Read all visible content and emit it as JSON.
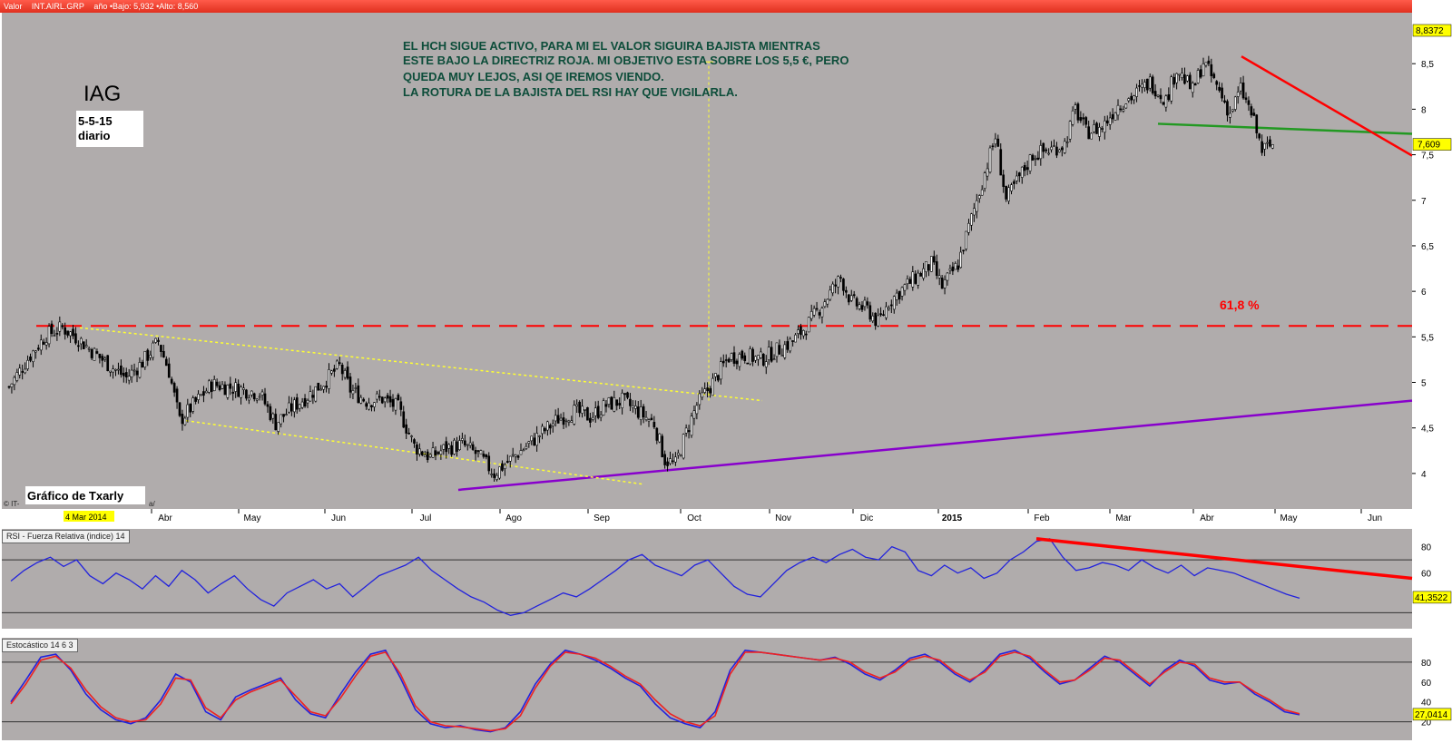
{
  "main_header": {
    "valor_label": "Valor",
    "symbol": "INT.AIRL.GRP",
    "range_text": "año •Bajo: 5,932 •Alto: 8,560"
  },
  "annotations": {
    "ticker": "IAG",
    "date_line1": "5-5-15",
    "date_line2": "diario",
    "comment_lines": [
      "EL  HCH  SIGUE  ACTIVO, PARA  MI EL VALOR SIGUIRA BAJISTA MIENTRAS",
      "ESTE BAJO LA  DIRECTRIZ ROJA. MI OBJETIVO ESTA  SOBRE LOS  5,5 €, PERO",
      "QUEDA MUY LEJOS, ASI QE IREMOS VIENDO.",
      "LA  ROTURA  DE LA BAJISTA DEL RSI HAY QUE VIGILARLA."
    ],
    "fib_label": "61,8 %",
    "credit": "Gráfico de Txarly",
    "start_date": "4 Mar 2014",
    "source": "© IT-",
    "source_tail": "a/"
  },
  "colors": {
    "plot_bg": "#b0acac",
    "red_line": "#ff0000",
    "green_line": "#229922",
    "purple_line": "#8800cc",
    "yellow_line": "#ffff33",
    "rsi_line": "#2222dd",
    "stoch_k": "#2222dd",
    "stoch_d": "#ee2222",
    "price_tag": "#ffff00"
  },
  "chart_data": [
    {
      "type": "candlestick",
      "x_ticks": [
        "Abr",
        "May",
        "Jun",
        "Jul",
        "Ago",
        "Sep",
        "Oct",
        "Nov",
        "Dic",
        "2015",
        "Feb",
        "Mar",
        "Abr",
        "May",
        "Jun"
      ],
      "y_ticks": [
        "4",
        "4,5",
        "5",
        "5,5",
        "6",
        "6,5",
        "7",
        "7,5",
        "8",
        "8,5"
      ],
      "ylim": [
        3.7,
        9.0
      ],
      "last_value": "7,609",
      "top_value": "8,8372",
      "series": [
        {
          "date_index": 0,
          "close": 4.95
        },
        {
          "date_index": 8,
          "close": 5.3
        },
        {
          "date_index": 14,
          "close": 5.52
        },
        {
          "date_index": 20,
          "close": 5.6
        },
        {
          "date_index": 26,
          "close": 5.48
        },
        {
          "date_index": 32,
          "close": 5.32
        },
        {
          "date_index": 38,
          "close": 5.18
        },
        {
          "date_index": 44,
          "close": 5.05
        },
        {
          "date_index": 50,
          "close": 5.22
        },
        {
          "date_index": 56,
          "close": 5.45
        },
        {
          "date_index": 60,
          "close": 5.12
        },
        {
          "date_index": 64,
          "close": 4.58
        },
        {
          "date_index": 70,
          "close": 4.78
        },
        {
          "date_index": 76,
          "close": 4.98
        },
        {
          "date_index": 82,
          "close": 4.95
        },
        {
          "date_index": 88,
          "close": 4.92
        },
        {
          "date_index": 94,
          "close": 4.88
        },
        {
          "date_index": 100,
          "close": 4.55
        },
        {
          "date_index": 106,
          "close": 4.72
        },
        {
          "date_index": 112,
          "close": 4.85
        },
        {
          "date_index": 118,
          "close": 5.0
        },
        {
          "date_index": 124,
          "close": 5.18
        },
        {
          "date_index": 128,
          "close": 4.92
        },
        {
          "date_index": 134,
          "close": 4.8
        },
        {
          "date_index": 140,
          "close": 4.82
        },
        {
          "date_index": 146,
          "close": 4.72
        },
        {
          "date_index": 152,
          "close": 4.3
        },
        {
          "date_index": 158,
          "close": 4.18
        },
        {
          "date_index": 164,
          "close": 4.28
        },
        {
          "date_index": 170,
          "close": 4.32
        },
        {
          "date_index": 176,
          "close": 4.2
        },
        {
          "date_index": 182,
          "close": 4.0
        },
        {
          "date_index": 188,
          "close": 4.15
        },
        {
          "date_index": 194,
          "close": 4.3
        },
        {
          "date_index": 200,
          "close": 4.45
        },
        {
          "date_index": 206,
          "close": 4.6
        },
        {
          "date_index": 212,
          "close": 4.68
        },
        {
          "date_index": 218,
          "close": 4.62
        },
        {
          "date_index": 224,
          "close": 4.75
        },
        {
          "date_index": 230,
          "close": 4.8
        },
        {
          "date_index": 236,
          "close": 4.68
        },
        {
          "date_index": 242,
          "close": 4.55
        },
        {
          "date_index": 246,
          "close": 4.15
        },
        {
          "date_index": 250,
          "close": 4.1
        },
        {
          "date_index": 254,
          "close": 4.45
        },
        {
          "date_index": 258,
          "close": 4.75
        },
        {
          "date_index": 264,
          "close": 5.0
        },
        {
          "date_index": 270,
          "close": 5.28
        },
        {
          "date_index": 276,
          "close": 5.3
        },
        {
          "date_index": 282,
          "close": 5.25
        },
        {
          "date_index": 288,
          "close": 5.35
        },
        {
          "date_index": 294,
          "close": 5.45
        },
        {
          "date_index": 300,
          "close": 5.65
        },
        {
          "date_index": 306,
          "close": 5.9
        },
        {
          "date_index": 312,
          "close": 6.15
        },
        {
          "date_index": 316,
          "close": 5.88
        },
        {
          "date_index": 322,
          "close": 5.8
        },
        {
          "date_index": 326,
          "close": 5.65
        },
        {
          "date_index": 330,
          "close": 5.88
        },
        {
          "date_index": 336,
          "close": 6.05
        },
        {
          "date_index": 342,
          "close": 6.2
        },
        {
          "date_index": 346,
          "close": 6.3
        },
        {
          "date_index": 350,
          "close": 6.05
        },
        {
          "date_index": 356,
          "close": 6.3
        },
        {
          "date_index": 362,
          "close": 6.9
        },
        {
          "date_index": 366,
          "close": 7.3
        },
        {
          "date_index": 370,
          "close": 7.7
        },
        {
          "date_index": 374,
          "close": 7.0
        },
        {
          "date_index": 378,
          "close": 7.2
        },
        {
          "date_index": 384,
          "close": 7.5
        },
        {
          "date_index": 390,
          "close": 7.55
        },
        {
          "date_index": 396,
          "close": 7.62
        },
        {
          "date_index": 400,
          "close": 8.0
        },
        {
          "date_index": 404,
          "close": 7.75
        },
        {
          "date_index": 410,
          "close": 7.8
        },
        {
          "date_index": 416,
          "close": 8.05
        },
        {
          "date_index": 422,
          "close": 8.15
        },
        {
          "date_index": 428,
          "close": 8.3
        },
        {
          "date_index": 434,
          "close": 8.1
        },
        {
          "date_index": 438,
          "close": 8.45
        },
        {
          "date_index": 444,
          "close": 8.2
        },
        {
          "date_index": 448,
          "close": 8.52
        },
        {
          "date_index": 454,
          "close": 8.2
        },
        {
          "date_index": 458,
          "close": 7.95
        },
        {
          "date_index": 462,
          "close": 8.22
        },
        {
          "date_index": 466,
          "close": 7.95
        },
        {
          "date_index": 470,
          "close": 7.55
        },
        {
          "date_index": 474,
          "close": 7.61
        }
      ],
      "trendlines": [
        {
          "name": "hch_neckline",
          "color": "green"
        },
        {
          "name": "directriz_roja",
          "color": "red"
        },
        {
          "name": "fib_61_8",
          "value": 5.62,
          "color": "red",
          "dashed": true
        },
        {
          "name": "soporte",
          "color": "purple"
        },
        {
          "name": "canal_superior",
          "color": "yellow",
          "dashed": true
        },
        {
          "name": "canal_inferior",
          "color": "yellow",
          "dashed": true
        }
      ]
    },
    {
      "type": "line",
      "title": "RSI - Fuerza Relativa (indice) 14",
      "y_ticks": [
        "40",
        "60",
        "80"
      ],
      "ylim": [
        20,
        90
      ],
      "levels": [
        30,
        70
      ],
      "last_value": "41,3522",
      "values": [
        54,
        62,
        68,
        72,
        65,
        70,
        58,
        52,
        60,
        55,
        48,
        58,
        50,
        62,
        55,
        45,
        52,
        58,
        48,
        40,
        35,
        45,
        50,
        55,
        48,
        52,
        42,
        50,
        58,
        62,
        66,
        72,
        62,
        55,
        48,
        42,
        38,
        32,
        28,
        30,
        35,
        40,
        45,
        42,
        48,
        55,
        62,
        70,
        74,
        66,
        62,
        58,
        66,
        70,
        60,
        50,
        44,
        42,
        52,
        62,
        68,
        72,
        68,
        74,
        78,
        72,
        70,
        80,
        76,
        62,
        58,
        66,
        60,
        64,
        56,
        60,
        70,
        76,
        84,
        86,
        72,
        62,
        64,
        68,
        66,
        62,
        70,
        64,
        60,
        66,
        58,
        64,
        62,
        60,
        56,
        52,
        48,
        44,
        41
      ]
    },
    {
      "type": "line",
      "title": "Estocástico 14 6 3",
      "y_ticks": [
        "20",
        "40",
        "60",
        "80"
      ],
      "ylim": [
        5,
        100
      ],
      "levels": [
        20,
        80
      ],
      "last_value": "27,0414",
      "series": [
        {
          "name": "K",
          "values": [
            40,
            62,
            85,
            88,
            72,
            48,
            32,
            22,
            18,
            24,
            42,
            68,
            60,
            30,
            22,
            45,
            52,
            58,
            64,
            42,
            28,
            24,
            48,
            70,
            88,
            92,
            64,
            32,
            18,
            14,
            16,
            12,
            10,
            14,
            30,
            58,
            78,
            92,
            88,
            82,
            74,
            64,
            56,
            38,
            24,
            18,
            14,
            30,
            72,
            92,
            90,
            88,
            86,
            84,
            82,
            85,
            78,
            68,
            62,
            72,
            84,
            88,
            80,
            68,
            60,
            72,
            88,
            92,
            84,
            70,
            58,
            62,
            74,
            86,
            80,
            68,
            56,
            72,
            82,
            76,
            62,
            58,
            60,
            48,
            40,
            30,
            27
          ]
        },
        {
          "name": "D",
          "values": [
            38,
            58,
            82,
            86,
            74,
            52,
            35,
            24,
            20,
            22,
            38,
            64,
            62,
            34,
            24,
            42,
            50,
            56,
            62,
            46,
            30,
            26,
            44,
            66,
            86,
            90,
            68,
            36,
            20,
            16,
            15,
            13,
            11,
            13,
            26,
            54,
            76,
            90,
            88,
            84,
            76,
            66,
            58,
            42,
            28,
            20,
            16,
            26,
            68,
            90,
            90,
            88,
            86,
            84,
            82,
            84,
            80,
            70,
            64,
            70,
            82,
            86,
            82,
            70,
            62,
            70,
            86,
            90,
            86,
            72,
            60,
            62,
            72,
            84,
            82,
            70,
            58,
            70,
            80,
            78,
            64,
            60,
            60,
            50,
            42,
            32,
            28
          ]
        }
      ]
    }
  ]
}
